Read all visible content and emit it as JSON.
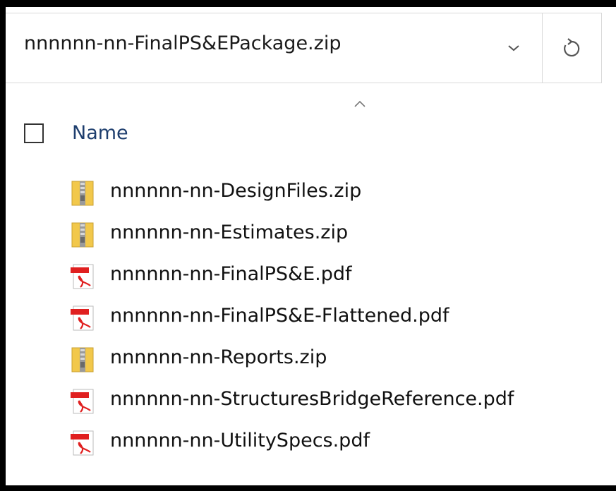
{
  "address_bar": {
    "path": "nnnnnn-nn-FinalPS&EPackage.zip",
    "dropdown_icon": "chevron-down-icon",
    "refresh_icon": "refresh-icon"
  },
  "column_header": {
    "name_label": "Name",
    "sort_icon": "sort-ascending-icon"
  },
  "files": [
    {
      "name": "nnnnnn-nn-DesignFiles.zip",
      "icon": "zip-folder-icon"
    },
    {
      "name": "nnnnnn-nn-Estimates.zip",
      "icon": "zip-folder-icon"
    },
    {
      "name": "nnnnnn-nn-FinalPS&E.pdf",
      "icon": "pdf-icon"
    },
    {
      "name": "nnnnnn-nn-FinalPS&E-Flattened.pdf",
      "icon": "pdf-icon"
    },
    {
      "name": "nnnnnn-nn-Reports.zip",
      "icon": "zip-folder-icon"
    },
    {
      "name": "nnnnnn-nn-StructuresBridgeReference.pdf",
      "icon": "pdf-icon"
    },
    {
      "name": "nnnnnn-nn-UtilitySpecs.pdf",
      "icon": "pdf-icon"
    }
  ],
  "colors": {
    "header_text": "#1e3e6e",
    "pdf_red": "#e02020",
    "zip_yellow": "#f2c84b"
  }
}
